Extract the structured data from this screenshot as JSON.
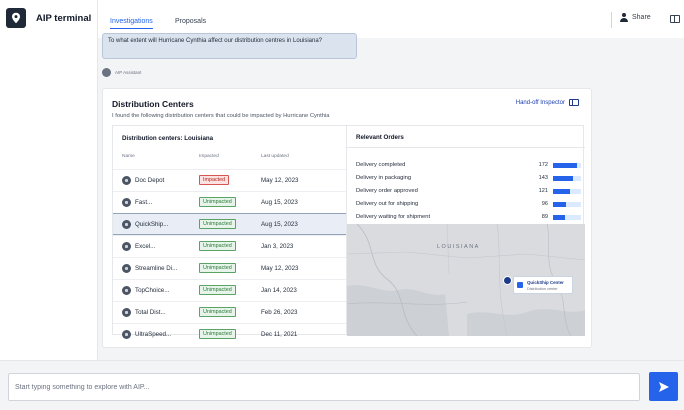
{
  "app": {
    "title": "AIP terminal",
    "logo_icon": "location-pin-icon"
  },
  "header": {
    "tabs": [
      {
        "label": "Investigations",
        "active": true
      },
      {
        "label": "Proposals",
        "active": false
      }
    ],
    "share_label": "Share",
    "share_icon": "person-icon",
    "panel_icon": "panel-toggle-icon"
  },
  "conversation": {
    "user_message": "To what extent will Hurricane Cynthia affect our distribution centres in Louisiana?",
    "assistant_label": "AIP Assistant"
  },
  "card": {
    "title": "Distribution Centers",
    "subtitle": "I found the following distribution centers that could be impacted by Hurricane Cynthia",
    "handoff_label": "Hand-off Inspector",
    "table": {
      "title": "Distribution centers: Louisiana",
      "columns": [
        "Name",
        "Impacted",
        "Last updated"
      ],
      "rows": [
        {
          "name": "Doc Depot",
          "status": "Impacted",
          "updated": "May 12, 2023",
          "selected": false
        },
        {
          "name": "Fast...",
          "status": "Unimpacted",
          "updated": "Aug 15, 2023",
          "selected": false
        },
        {
          "name": "QuickShip...",
          "status": "Unimpacted",
          "updated": "Aug 15, 2023",
          "selected": true
        },
        {
          "name": "Excel...",
          "status": "Unimpacted",
          "updated": "Jan 3, 2023",
          "selected": false
        },
        {
          "name": "Streamline Di...",
          "status": "Unimpacted",
          "updated": "May 12, 2023",
          "selected": false
        },
        {
          "name": "TopChoice...",
          "status": "Unimpacted",
          "updated": "Jan 14, 2023",
          "selected": false
        },
        {
          "name": "Total Dist...",
          "status": "Unimpacted",
          "updated": "Feb 26, 2023",
          "selected": false
        },
        {
          "name": "UltraSpeed...",
          "status": "Unimpacted",
          "updated": "Dec 11, 2021",
          "selected": false
        }
      ]
    },
    "orders": {
      "title": "Relevant Orders",
      "items": [
        {
          "label": "Delivery completed",
          "count": 172,
          "fraction": 0.85
        },
        {
          "label": "Delivery in packaging",
          "count": 143,
          "fraction": 0.7
        },
        {
          "label": "Delivery order approved",
          "count": 121,
          "fraction": 0.6
        },
        {
          "label": "Delivery out for shipping",
          "count": 96,
          "fraction": 0.47
        },
        {
          "label": "Delivery waiting for shipment",
          "count": 89,
          "fraction": 0.44
        }
      ]
    },
    "map": {
      "region_label": "LOUISIANA",
      "tooltip_title": "QuickShip Center",
      "tooltip_subtitle": "Distribution center"
    }
  },
  "composer": {
    "placeholder": "Start typing something to explore with AIP...",
    "send_icon": "send-arrow-icon"
  },
  "colors": {
    "accent": "#2563eb",
    "impacted": "#b42318",
    "unimpacted": "#2f7a3b"
  }
}
